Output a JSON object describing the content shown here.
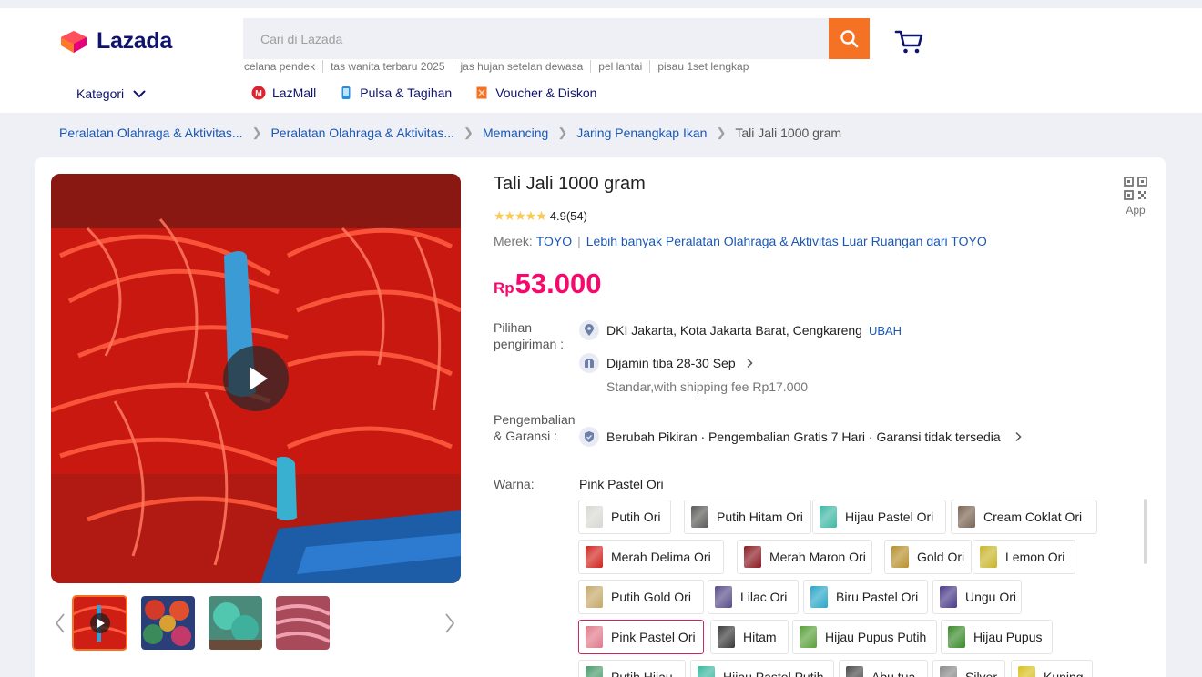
{
  "header": {
    "logo_text": "Lazada",
    "search_placeholder": "Cari di Lazada",
    "suggestions": [
      "celana pendek",
      "tas wanita terbaru 2025",
      "jas hujan setelan dewasa",
      "pel lantai",
      "pisau 1set lengkap"
    ],
    "kategori_label": "Kategori",
    "quick_links": [
      "LazMall",
      "Pulsa & Tagihan",
      "Voucher & Diskon"
    ]
  },
  "breadcrumb": [
    "Peralatan Olahraga & Aktivitas...",
    "Peralatan Olahraga & Aktivitas...",
    "Memancing",
    "Jaring Penangkap Ikan",
    "Tali Jali 1000 gram"
  ],
  "product": {
    "title": "Tali Jali 1000 gram",
    "app_label": "App",
    "rating_score": "4.9",
    "rating_count": "(54)",
    "brand_prefix": "Merek:",
    "brand_name": "TOYO",
    "brand_more": "Lebih banyak Peralatan Olahraga & Aktivitas Luar Ruangan dari TOYO",
    "price_currency": "Rp",
    "price_value": "53.000"
  },
  "delivery": {
    "label": "Pilihan pengiriman :",
    "location": "DKI Jakarta, Kota Jakarta Barat, Cengkareng",
    "change_label": "UBAH",
    "eta": "Dijamin tiba 28-30 Sep",
    "shipping": "Standar,with shipping fee Rp17.000"
  },
  "returns": {
    "label": "Pengembalian & Garansi :",
    "text": "Berubah Pikiran · Pengembalian Gratis 7 Hari · Garansi tidak tersedia"
  },
  "variants": {
    "label": "Warna:",
    "selected": "Pink Pastel Ori",
    "options": [
      {
        "name": "Putih Ori",
        "color": "#d8d8d2"
      },
      {
        "name": "Putih Hitam Ori",
        "color": "#5a5a58"
      },
      {
        "name": "Hijau Pastel Ori",
        "color": "#3fb8a4"
      },
      {
        "name": "Cream Coklat Ori",
        "color": "#7a6552"
      },
      {
        "name": "Merah Delima Ori",
        "color": "#d0251f"
      },
      {
        "name": "Merah Maron Ori",
        "color": "#8b1a22"
      },
      {
        "name": "Gold Ori",
        "color": "#b8902c"
      },
      {
        "name": "Lemon Ori",
        "color": "#c9b52a"
      },
      {
        "name": "Putih Gold Ori",
        "color": "#c4a86a"
      },
      {
        "name": "Lilac Ori",
        "color": "#5a4d8a"
      },
      {
        "name": "Biru Pastel Ori",
        "color": "#2aa6c8"
      },
      {
        "name": "Ungu Ori",
        "color": "#4a3a8a"
      },
      {
        "name": "Pink Pastel Ori",
        "color": "#e07a8a"
      },
      {
        "name": "Hitam",
        "color": "#3a3a3a"
      },
      {
        "name": "Hijau Pupus Putih",
        "color": "#5aa03a"
      },
      {
        "name": "Hijau Pupus",
        "color": "#3a8a2a"
      },
      {
        "name": "Putih Hijau",
        "color": "#4a9a6a"
      },
      {
        "name": "Hijau Pastel Putih",
        "color": "#3ab8a0"
      },
      {
        "name": "Abu tua",
        "color": "#4a4a4a"
      },
      {
        "name": "Silver",
        "color": "#8a8a8a"
      },
      {
        "name": "Kuning",
        "color": "#d8c020"
      }
    ]
  },
  "colors": {
    "accent": "#f57224",
    "price": "#f7086c",
    "link": "#1a57b5",
    "brand": "#0f136d"
  }
}
